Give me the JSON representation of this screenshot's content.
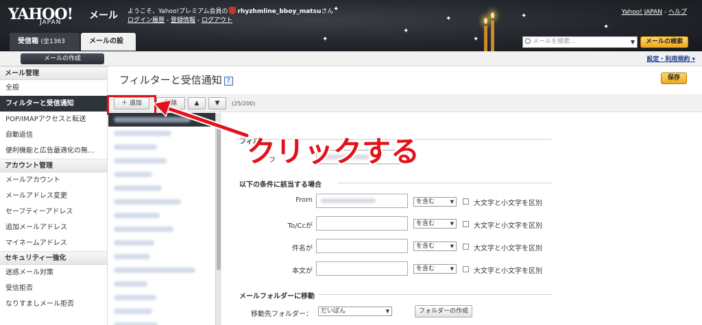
{
  "header": {
    "logo": "YAHOO!",
    "logo_sub": "JAPAN",
    "logo_mail": "メール",
    "welcome_prefix": "ようこそ、Yahoo!プレミアム会員の",
    "username": "rhyzhmline_bboy_matsu",
    "welcome_suffix": "さん",
    "login_history": "ログイン履歴",
    "registration": "登録情報",
    "logout": "ログアウト",
    "sep": " - ",
    "yahoo_japan": "Yahoo! JAPAN",
    "help": "ヘルプ"
  },
  "tabs": {
    "inbox": "受信箱",
    "inbox_count": "(全1363件)",
    "settings": "メールの設定"
  },
  "search": {
    "placeholder": "メールを検索...",
    "button": "メールの検索"
  },
  "subbar": {
    "compose": "メールの作成",
    "settings_help": "設定・利用規約"
  },
  "leftnav": {
    "sections": [
      {
        "title": "メール管理",
        "items": [
          "全般",
          "フィルターと受信通知",
          "POP/IMAPアクセスと転送",
          "自動返信",
          "便利機能と広告最適化の無…"
        ]
      },
      {
        "title": "アカウント管理",
        "items": [
          "メールアカウント",
          "メールアドレス変更",
          "セーフティーアドレス",
          "追加メールアドレス",
          "マイネームアドレス"
        ]
      },
      {
        "title": "セキュリティー強化",
        "items": [
          "迷惑メール対策",
          "受信拒否",
          "なりすましメール拒否"
        ]
      }
    ]
  },
  "main": {
    "title": "フィルターと受信通知",
    "help_icon": "?",
    "save": "保存",
    "toolbar": {
      "add": "＋ 追加",
      "delete": "削除",
      "up": "▲",
      "down": "▼",
      "count": "(25/200)"
    },
    "form": {
      "filter_name_section": "フィル",
      "filter_name_label": "フ",
      "conditions_section": "以下の条件に該当する場合",
      "rows": [
        {
          "label": "From",
          "select": "を含む",
          "case": "大文字と小文字を区別"
        },
        {
          "label": "To/Ccが",
          "select": "を含む",
          "case": "大文字と小文字を区別"
        },
        {
          "label": "件名が",
          "select": "を含む",
          "case": "大文字と小文字を区別"
        },
        {
          "label": "本文が",
          "select": "を含む",
          "case": "大文字と小文字を区別"
        }
      ],
      "move_section": "メールフォルダーに移動",
      "dest_label": "移動先フォルダー：",
      "dest_value": "だいぼん",
      "create_folder": "フォルダーの作成"
    }
  },
  "annotation": {
    "text": "クリックする",
    "color": "#e2121b"
  }
}
